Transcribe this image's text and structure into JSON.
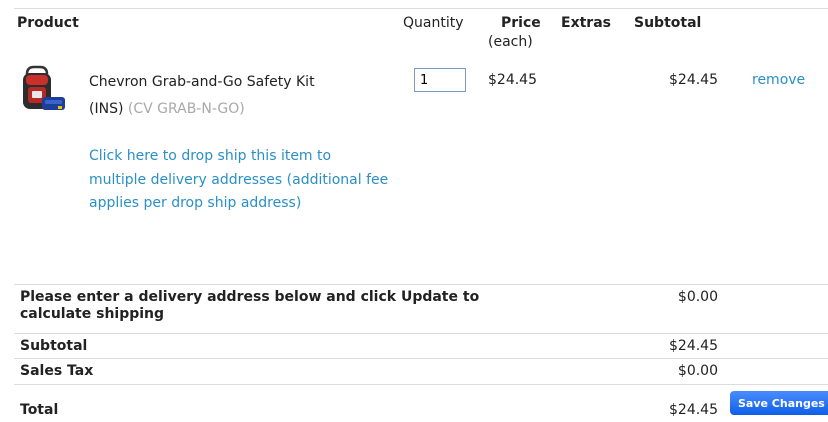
{
  "header": {
    "product": "Product",
    "quantity": "Quantity",
    "price": "Price",
    "price_sub": "(each)",
    "extras": "Extras",
    "subtotal": "Subtotal"
  },
  "item": {
    "image_icon": "backpack-safety-kit-icon",
    "name_line1": "Chevron Grab-and-Go Safety Kit",
    "name_line2": "(INS)",
    "sku": "(CV GRAB-N-GO)",
    "dropship_link": "Click here to drop ship this item to multiple delivery addresses (additional fee applies per drop ship address)",
    "quantity": "1",
    "price": "$24.45",
    "subtotal": "$24.45",
    "remove": "remove"
  },
  "summary": {
    "shipping_label_line1": "Please enter a delivery address below and click Update to",
    "shipping_label_line2": "calculate shipping",
    "shipping_value": "$0.00",
    "subtotal_label": "Subtotal",
    "subtotal_value": "$24.45",
    "tax_label": "Sales Tax",
    "tax_value": "$0.00",
    "total_label": "Total",
    "total_value": "$24.45",
    "save_button": "Save Changes"
  },
  "colors": {
    "link": "#2a8fc7",
    "button": "#1a6af0",
    "divider": "#dcdcdc"
  }
}
